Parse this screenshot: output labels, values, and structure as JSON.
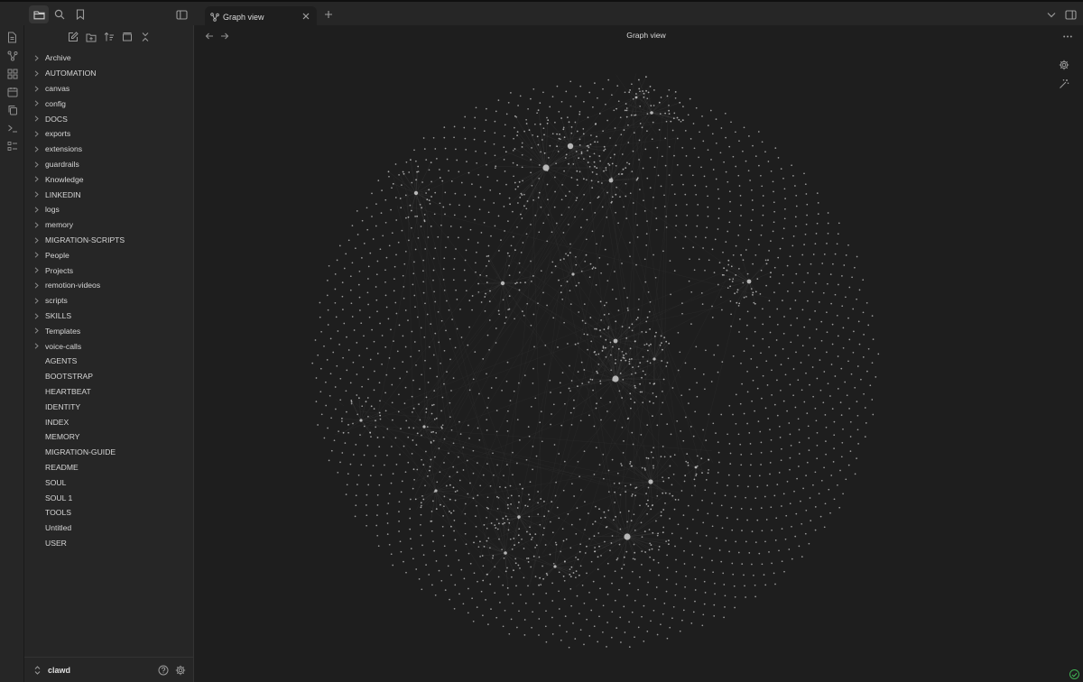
{
  "titlebar": {
    "icons": [
      "folder-icon",
      "search-icon",
      "bookmark-icon",
      "sidebar-toggle-icon"
    ],
    "tab": {
      "label": "Graph view",
      "icon": "graph-icon"
    },
    "right_icons": [
      "chevron-down-icon",
      "right-sidebar-toggle-icon"
    ]
  },
  "ribbon": {
    "icons": [
      "file-icon",
      "graph-icon",
      "dashboard-icon",
      "calendar-icon",
      "copy-icon",
      "terminal-icon",
      "checklist-icon"
    ]
  },
  "sidebar": {
    "toolbar": [
      "new-note-icon",
      "new-folder-icon",
      "sort-icon",
      "collapse-view-icon",
      "collapse-all-icon"
    ],
    "folders": [
      "Archive",
      "AUTOMATION",
      "canvas",
      "config",
      "DOCS",
      "exports",
      "extensions",
      "guardrails",
      "Knowledge",
      "LINKEDIN",
      "logs",
      "memory",
      "MIGRATION-SCRIPTS",
      "People",
      "Projects",
      "remotion-videos",
      "scripts",
      "SKILLS",
      "Templates",
      "voice-calls"
    ],
    "files": [
      "AGENTS",
      "BOOTSTRAP",
      "HEARTBEAT",
      "IDENTITY",
      "INDEX",
      "MEMORY",
      "MIGRATION-GUIDE",
      "README",
      "SOUL",
      "SOUL 1",
      "TOOLS",
      "Untitled",
      "USER"
    ],
    "vault_name": "clawd"
  },
  "main": {
    "title": "Graph view"
  },
  "colors": {
    "background": "#1e1e1e",
    "panel": "#262626",
    "node": "#bfbfbf",
    "link": "#3a3a3a",
    "status_ok": "#3fae53"
  }
}
